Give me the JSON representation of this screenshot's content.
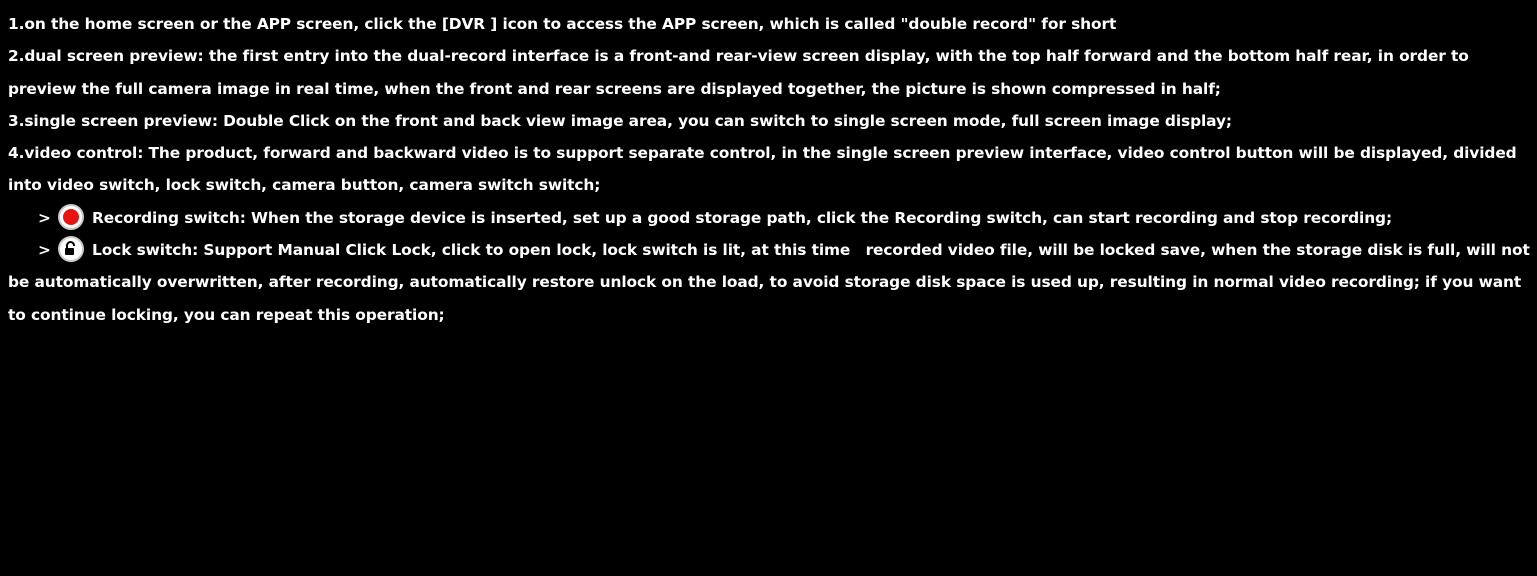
{
  "colors": {
    "background": "#000000",
    "text": "#ffffff",
    "record_dot": "#e8130f"
  },
  "paragraphs": {
    "p1": "1.on the home screen or the APP screen, click the [DVR ] icon to access the APP screen, which is called \"double record\" for short",
    "p2": "2.dual screen preview: the first entry into the dual-record interface is a front-and rear-view screen display, with the top half forward and the bottom half rear, in order to preview the full camera image in real time, when the front and rear screens are displayed together, the picture is shown compressed in half;",
    "p3": "3.single screen preview: Double Click on the front and back view image area, you can switch to single screen mode, full screen image display;",
    "p4": "4.video control: The product, forward and backward video is to support separate control, in the single screen preview interface, video control button will be displayed, divided into video switch, lock switch, camera button, camera switch switch;"
  },
  "bullets": [
    {
      "marker": ">",
      "icon": "record-icon",
      "text": "Recording switch: When the storage device is inserted, set up a good storage path, click the Recording switch, can start recording and stop recording;"
    },
    {
      "marker": ">",
      "icon": "lock-icon",
      "text": "Lock switch: Support Manual Click Lock, click to open lock, lock switch is lit, at this time　recorded video file, will be locked save, when the storage disk is full, will not be automatically overwritten, after recording, automatically restore unlock on the load, to avoid storage disk space is used up, resulting in normal video recording; if you want to continue locking, you can repeat this operation;"
    }
  ]
}
